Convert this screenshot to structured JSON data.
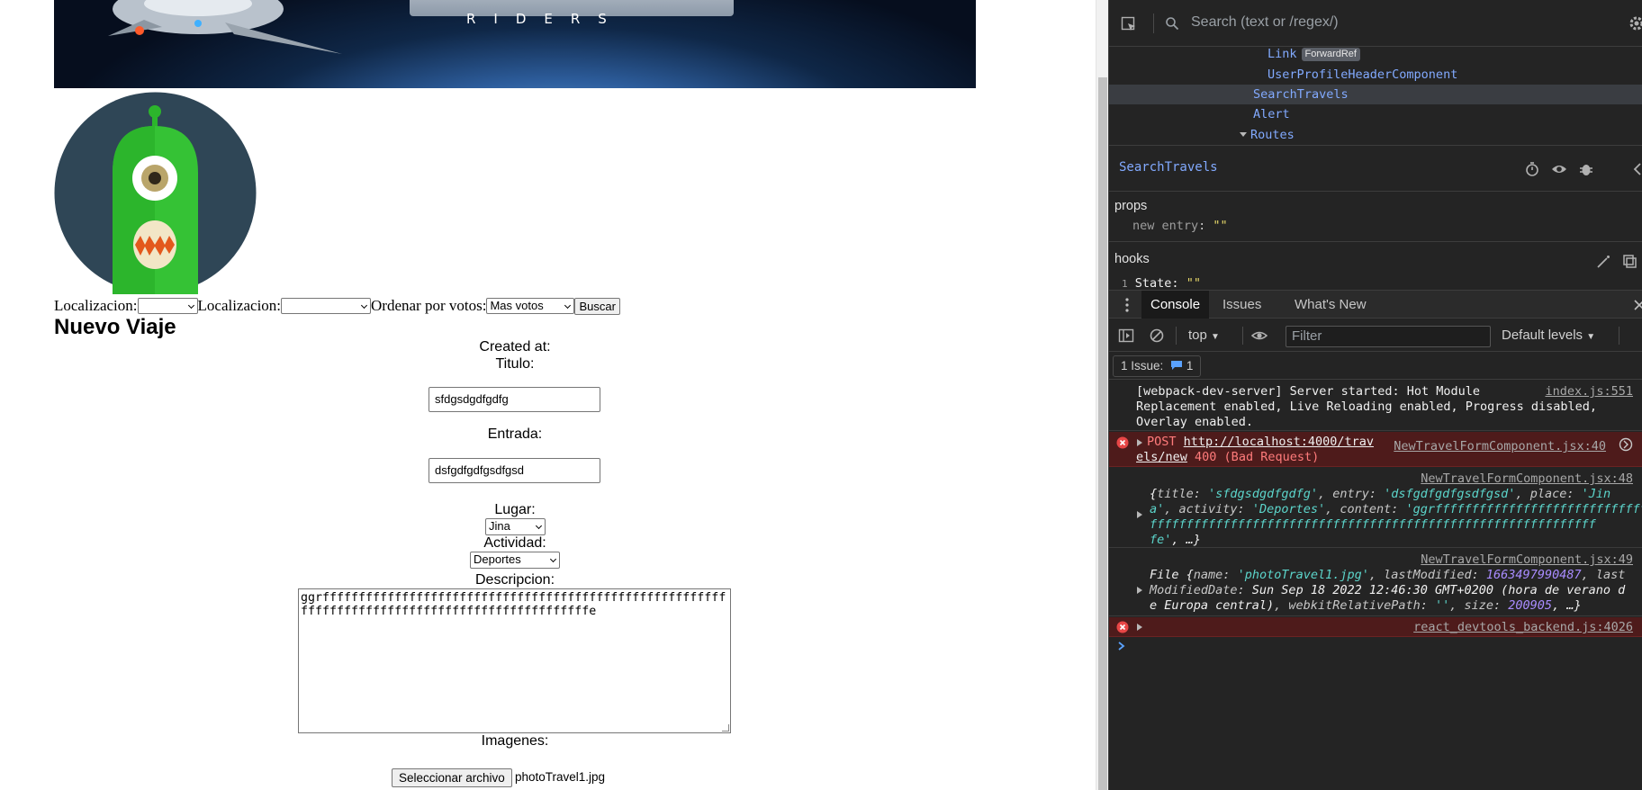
{
  "banner": {
    "subtitle": "RIDERS"
  },
  "filters": {
    "location1_label": "Localizacion:",
    "location1_value": "",
    "location2_label": "Localizacion:",
    "location2_value": "",
    "order_label": "Ordenar por votos:",
    "order_value": "Mas votos",
    "search_button": "Buscar"
  },
  "form": {
    "title": "Nuevo Viaje",
    "created_at_label": "Created at:",
    "titulo_label": "Titulo:",
    "titulo_value": "sfdgsdgdfgdfg",
    "entrada_label": "Entrada:",
    "entrada_value": "dsfgdfgdfgsdfgsd",
    "lugar_label": "Lugar:",
    "lugar_value": "Jina",
    "actividad_label": "Actividad:",
    "actividad_value": "Deportes",
    "descripcion_label": "Descripcion:",
    "descripcion_value": "ggrffffffffffffffffffffffffffffffffffffffffffffffffffffffffffffffffffffffffffffffffffffffffffffffffe",
    "imagenes_label": "Imagenes:",
    "file_button": "Seleccionar archivo",
    "file_name": "photoTravel1.jpg"
  },
  "devtools": {
    "search_placeholder": "Search (text or /regex/)",
    "tree": [
      {
        "name": "Link",
        "badge": "ForwardRef"
      },
      {
        "name": "UserProfileHeaderComponent"
      },
      {
        "name": "SearchTravels"
      },
      {
        "name": "Alert"
      },
      {
        "name": "Routes"
      }
    ],
    "selected_component": "SearchTravels",
    "props_title": "props",
    "prop_key": "new entry",
    "prop_value": "\"\"",
    "hooks_title": "hooks",
    "hook_index": "1",
    "hook_key": "State:",
    "hook_value": "\"\"",
    "drawer_tabs": [
      "Console",
      "Issues",
      "What's New"
    ],
    "context": "top",
    "filter_placeholder": "Filter",
    "levels": "Default levels",
    "issues_label": "1 Issue:",
    "issues_count": "1",
    "logs": [
      {
        "lines": [
          "[webpack-dev-server] Server started: Hot Module",
          "Replacement enabled, Live Reloading enabled, Progress disabled,",
          "Overlay enabled."
        ],
        "source": "index.js:551"
      },
      {
        "method": "POST",
        "url_line1": "http://localhost:4000/trav",
        "url_line2": "els/new",
        "status": "400 (Bad Request)",
        "source": "NewTravelFormComponent.jsx:40"
      },
      {
        "source": "NewTravelFormComponent.jsx:48",
        "obj_title": "'sfdgsdgdfgdfg'",
        "obj_entry": "'dsfgdfgdfgsdfgsd'",
        "obj_place_a": "'Jin",
        "obj_place_b": "a'",
        "obj_activity": "'Deportes'",
        "obj_content_a": "'ggrfffffffffffffffffffffffffffffff",
        "obj_content_b": "fffffffffffffffffffffffffffffffffffffffffffffffffffffffffffff",
        "obj_content_c": "fe'",
        "obj_more": ", …}"
      },
      {
        "source": "NewTravelFormComponent.jsx:49",
        "file_name": "'photoTravel1.jpg'",
        "last_modified": "1663497990487",
        "date_a": "Sun Sep 18 2022 12:46:30 GMT+0200 (hora de verano d",
        "date_b": "e Europa central)",
        "relative_path": "''",
        "size": "200905"
      },
      {
        "source": "react_devtools_backend.js:4026"
      }
    ]
  }
}
